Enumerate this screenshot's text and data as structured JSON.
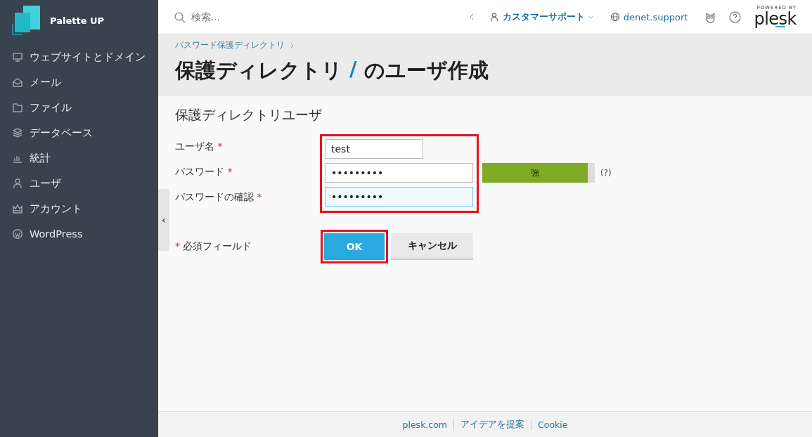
{
  "sidebar": {
    "brand": "Palette UP",
    "items": [
      {
        "label": "ウェブサイトとドメイン",
        "kind": "monitor"
      },
      {
        "label": "メール",
        "kind": "mail"
      },
      {
        "label": "ファイル",
        "kind": "folder"
      },
      {
        "label": "データベース",
        "kind": "layers"
      },
      {
        "label": "統計",
        "kind": "chart"
      },
      {
        "label": "ユーザ",
        "kind": "user"
      },
      {
        "label": "アカウント",
        "kind": "crown"
      },
      {
        "label": "WordPress",
        "kind": "wordpress"
      }
    ]
  },
  "topbar": {
    "search_placeholder": "検索...",
    "user": "カスタマーサポート",
    "domain": "denet.support",
    "powered_by": "POWERED BY",
    "logo": "plesk"
  },
  "breadcrumb": "パスワード保護ディレクトリ",
  "title_parts": [
    "保護ディレクトリ",
    "/",
    "のユーザ作成"
  ],
  "section_title": "保護ディレクトリユーザ",
  "form": {
    "highlighted": true,
    "fields": [
      {
        "label": "ユーザ名",
        "required": true,
        "value": "test",
        "kind": "short",
        "focused": false
      },
      {
        "label": "パスワード",
        "required": true,
        "value": "•••••••••",
        "kind": "password",
        "focused": false,
        "strength": {
          "label": "強",
          "level": 0.94
        },
        "help": "(?)"
      },
      {
        "label": "パスワードの確認",
        "required": true,
        "value": "•••••••••",
        "kind": "password",
        "focused": true
      }
    ]
  },
  "required_note": "必須フィールド",
  "required_mark": "*",
  "buttons": [
    {
      "label": "OK",
      "primary": true,
      "highlighted": true
    },
    {
      "label": "キャンセル",
      "primary": false,
      "highlighted": false
    }
  ],
  "collapse_toggle": "‹",
  "footer": [
    "plesk.com",
    "アイデアを提案",
    "Cookie"
  ]
}
